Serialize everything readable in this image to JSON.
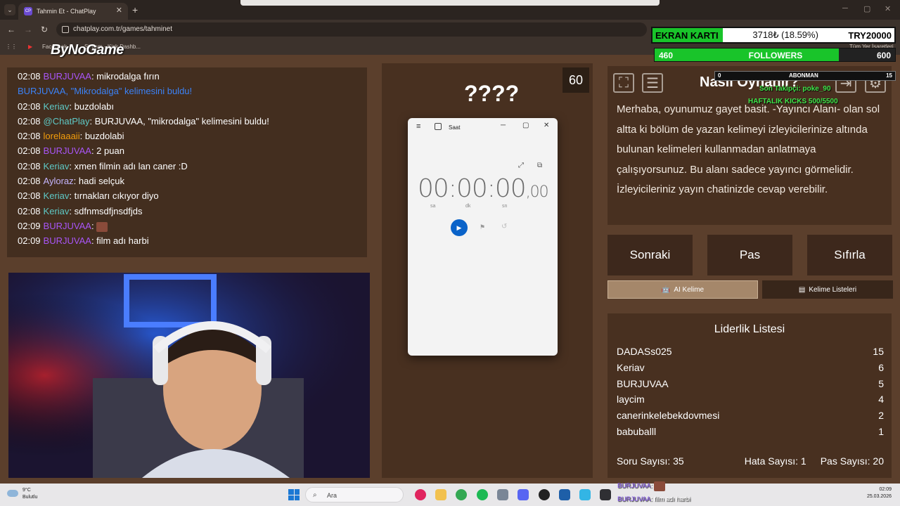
{
  "browser": {
    "tab_title": "Tahmin Et - ChatPlay",
    "tab_favicon": "CP",
    "url": "chatplay.com.tr/games/tahminet",
    "bookmarks": [
      "Facebook",
      "Stream - Kick Dashb...",
      "Tüm Yer İşaretleri"
    ],
    "icons": [
      "back-icon",
      "forward-icon",
      "reload-icon",
      "apps-icon"
    ]
  },
  "logo_text": "ByNoGame",
  "chat": [
    {
      "time": "02:08",
      "user": "BURJUVAA",
      "color": "#a855f7",
      "msg": "mikrodalga fırın"
    },
    {
      "time": "",
      "user": "",
      "color": "",
      "msg": "",
      "system": "BURJUVAA, \"Mikrodalga\" kelimesini buldu!"
    },
    {
      "time": "02:08",
      "user": "Keriav",
      "color": "#5ec9c6",
      "msg": "buzdolabı"
    },
    {
      "time": "02:08",
      "user": "@ChatPlay",
      "color": "#5ec9c6",
      "msg": "BURJUVAA, \"mikrodalga\" kelimesini buldu!"
    },
    {
      "time": "02:08",
      "user": "lorelaaaii",
      "color": "#f59e0b",
      "msg": "buzdolabi"
    },
    {
      "time": "02:08",
      "user": "BURJUVAA",
      "color": "#a855f7",
      "msg": "2 puan"
    },
    {
      "time": "02:08",
      "user": "Keriav",
      "color": "#5ec9c6",
      "msg": "xmen filmin adı lan caner :D"
    },
    {
      "time": "02:08",
      "user": "Ayloraz",
      "color": "#c4b5fd",
      "msg": "hadi selçuk"
    },
    {
      "time": "02:08",
      "user": "Keriav",
      "color": "#5ec9c6",
      "msg": "tırnakları cıkıyor diyo"
    },
    {
      "time": "02:08",
      "user": "Keriav",
      "color": "#5ec9c6",
      "msg": "sdfnmsdfjnsdfjds"
    },
    {
      "time": "02:09",
      "user": "BURJUVAA",
      "color": "#a855f7",
      "msg": "",
      "emote": true
    },
    {
      "time": "02:09",
      "user": "BURJUVAA",
      "color": "#a855f7",
      "msg": "film adı harbi"
    }
  ],
  "game": {
    "timer": "60",
    "word": "????",
    "howto_title": "Nasıl Oynanır?",
    "howto_text": "Merhaba, oyunumuz gayet basit. -Yayıncı Alanı- olan sol altta ki bölüm de yazan kelimeyi izleyicilerinize altında bulunan kelimeleri kullanmadan anlatmaya çalışıyorsunuz. Bu alanı sadece yayıncı görmelidir. İzleyicileriniz yayın chatinizde cevap verebilir.",
    "buttons": {
      "next": "Sonraki",
      "pass": "Pas",
      "reset": "Sıfırla"
    },
    "tabs": {
      "ai": "AI Kelime",
      "lists": "Kelime Listeleri"
    },
    "leaderboard_title": "Liderlik Listesi",
    "leaderboard": [
      {
        "name": "DADASs025",
        "score": "15"
      },
      {
        "name": "Keriav",
        "score": "6"
      },
      {
        "name": "BURJUVAA",
        "score": "5"
      },
      {
        "name": "laycim",
        "score": "4"
      },
      {
        "name": "canerinkelebekdovmesi",
        "score": "2"
      },
      {
        "name": "babuballl",
        "score": "1"
      }
    ],
    "footer": {
      "questions": "Soru Sayısı: 35",
      "errors": "Hata Sayısı: 1",
      "passes": "Pas Sayısı: 20"
    }
  },
  "clock_app": {
    "title": "Saat",
    "time_main": "00:00:00",
    "time_ms": ",00",
    "units": [
      "sa",
      "dk",
      "sn"
    ]
  },
  "overlay": {
    "gpu_label": "EKRAN KARTI",
    "gpu_progress": "3718₺ (18.59%)",
    "gpu_goal": "TRY20000",
    "followers_count": "460",
    "followers_label": "FOLLOWERS",
    "followers_goal": "600",
    "followers_fraction": 0.767,
    "sub_count": "0",
    "sub_label": "ABONMAN",
    "sub_goal": "15",
    "last_follower": "Son Takipçi: poke_90",
    "weekly_kicks": "HAFTALIK KICKS 500/5500"
  },
  "taskbar": {
    "weather_temp": "9°C",
    "weather_desc": "Bulutlu",
    "search": "Ara",
    "time": "02:09",
    "date": "25.03.2026",
    "mini_chat": [
      {
        "user": "BURJUVAA",
        "msg": ""
      },
      {
        "user": "BURJUVAA",
        "msg": "film adı harbi"
      }
    ]
  }
}
